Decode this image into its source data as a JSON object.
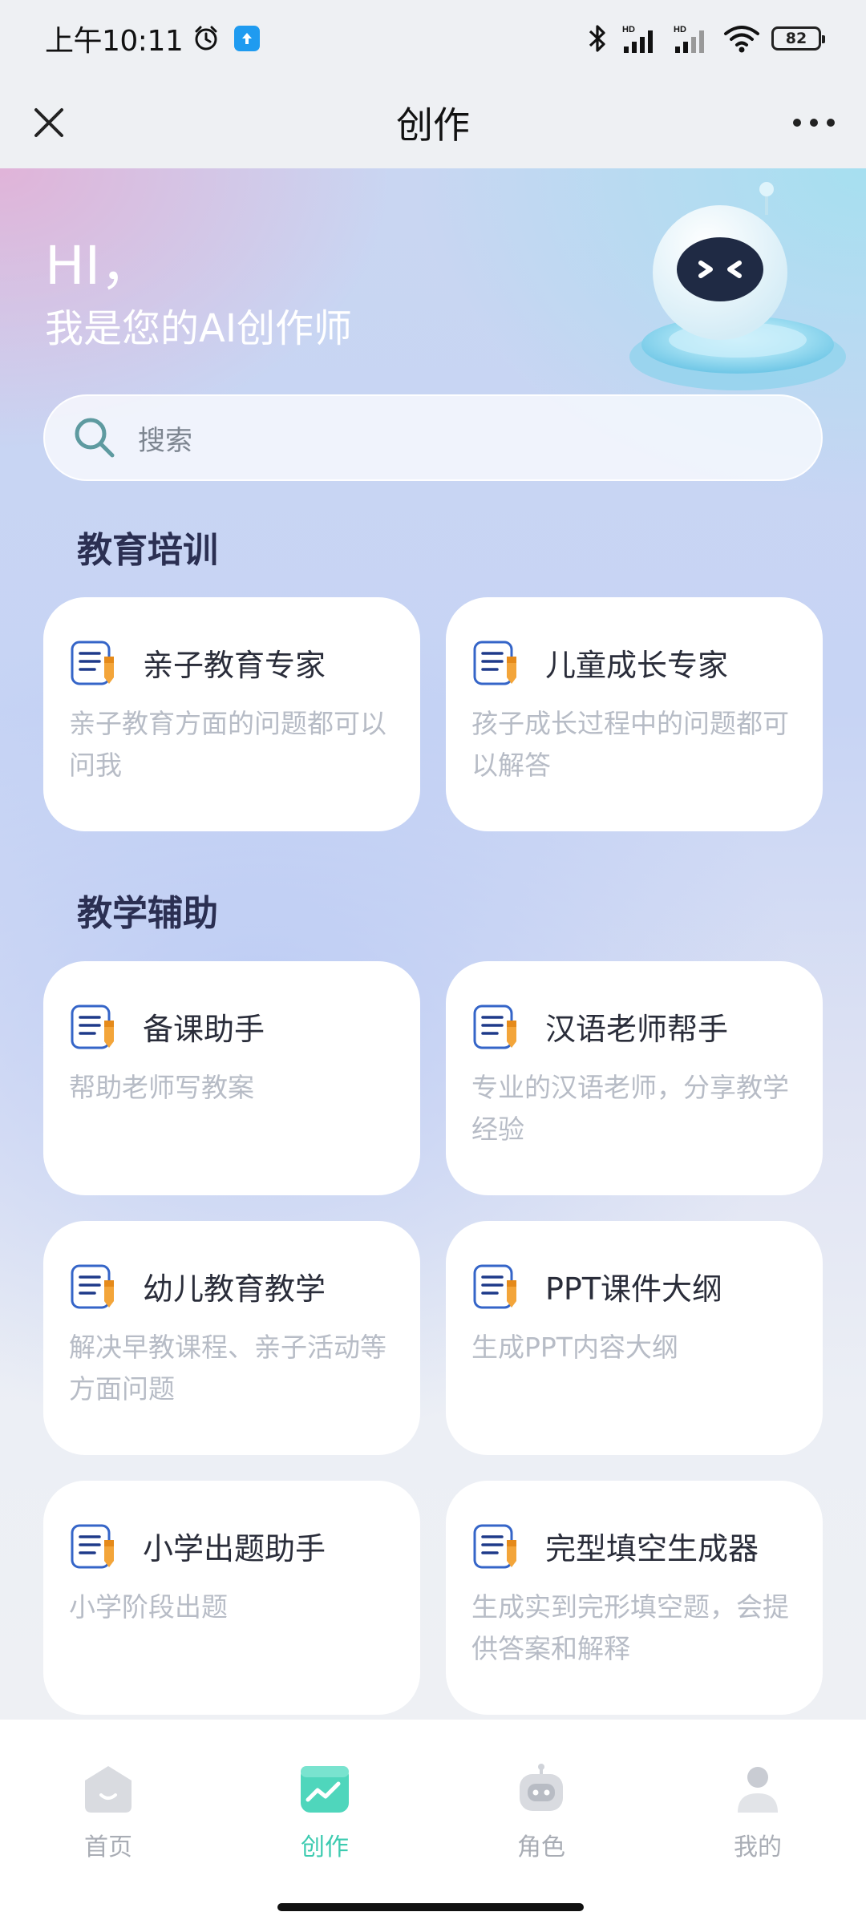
{
  "status_bar": {
    "time": "上午10:11",
    "battery": "82",
    "network": "HD"
  },
  "nav": {
    "title": "创作",
    "close_icon": "close-icon",
    "more_icon": "more-icon"
  },
  "greeting": {
    "hi": "HI，",
    "subtitle": "我是您的AI创作师"
  },
  "search": {
    "placeholder": "搜索"
  },
  "sections": [
    {
      "title": "教育培训",
      "cards": [
        {
          "title": "亲子教育专家",
          "desc": "亲子教育方面的问题都可以问我"
        },
        {
          "title": "儿童成长专家",
          "desc": "孩子成长过程中的问题都可以解答"
        }
      ]
    },
    {
      "title": "教学辅助",
      "cards": [
        {
          "title": "备课助手",
          "desc": "帮助老师写教案"
        },
        {
          "title": "汉语老师帮手",
          "desc": "专业的汉语老师，分享教学经验"
        },
        {
          "title": "幼儿教育教学",
          "desc": "解决早教课程、亲子活动等方面问题"
        },
        {
          "title": "PPT课件大纲",
          "desc": "生成PPT内容大纲"
        },
        {
          "title": "小学出题助手",
          "desc": "小学阶段出题"
        },
        {
          "title": "完型填空生成器",
          "desc": "生成实到完形填空题，会提供答案和解释"
        }
      ]
    }
  ],
  "tabs": [
    {
      "label": "首页",
      "icon": "home-icon"
    },
    {
      "label": "创作",
      "icon": "create-icon",
      "active": true
    },
    {
      "label": "角色",
      "icon": "robot-icon"
    },
    {
      "label": "我的",
      "icon": "profile-icon"
    }
  ],
  "colors": {
    "accent": "#3dcbb0",
    "section_title": "#2b2f52",
    "card_desc": "#b7bcc6"
  }
}
